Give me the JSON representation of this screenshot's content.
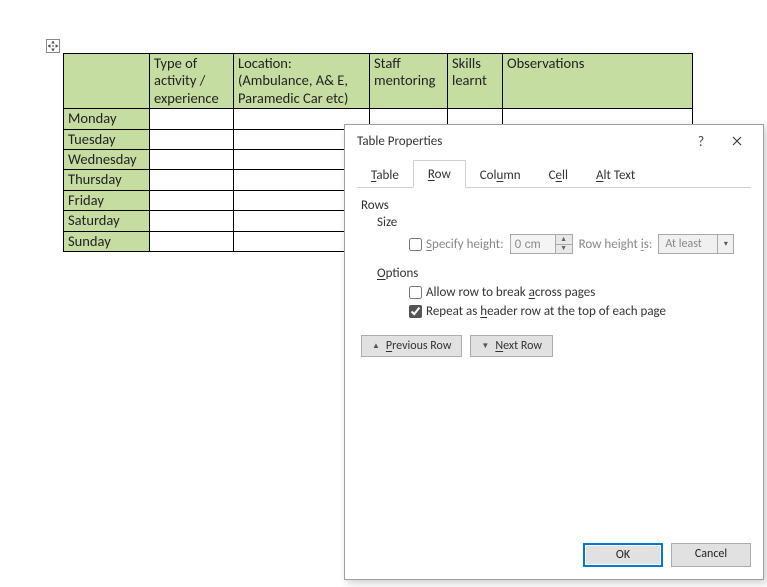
{
  "table": {
    "headers": [
      "",
      "Type of activity / experience",
      "Location: (Ambulance, A& E, Paramedic Car etc)",
      "Staff mentoring",
      "Skills learnt",
      "Observations"
    ],
    "rows": [
      "Monday",
      "Tuesday",
      "Wednesday",
      "Thursday",
      "Friday",
      "Saturday",
      "Sunday"
    ]
  },
  "dialog": {
    "title": "Table Properties",
    "help_label": "?",
    "tabs": {
      "table": "Table",
      "row": "Row",
      "column": "Column",
      "cell": "Cell",
      "alt": "Alt Text",
      "table_u": "T",
      "row_u": "R",
      "column_u": "u",
      "cell_u": "E",
      "alt_u": "A"
    },
    "active_tab": "Row",
    "rows_label": "Rows",
    "size_label": "Size",
    "specify_height_label": "Specify height:",
    "specify_height_u": "S",
    "specify_height_checked": false,
    "height_value": "0 cm",
    "row_height_is_label": "Row height is:",
    "row_height_is_u": "i",
    "row_height_value": "At least",
    "options_label": "Options",
    "options_u": "O",
    "allow_break_label": "Allow row to break across pages",
    "allow_break_u": "a",
    "allow_break_checked": false,
    "repeat_header_label": "Repeat as header row at the top of each page",
    "repeat_header_u": "h",
    "repeat_header_checked": true,
    "previous_row_label": "Previous Row",
    "previous_row_u": "P",
    "next_row_label": "Next Row",
    "next_row_u": "N",
    "ok_label": "OK",
    "cancel_label": "Cancel"
  }
}
